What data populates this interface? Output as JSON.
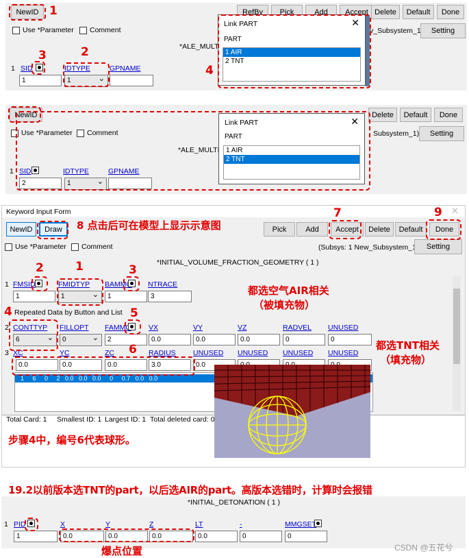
{
  "s1": {
    "newid": "NewID",
    "refby": "RefBy",
    "pick": "Pick",
    "add": "Add",
    "accept": "Accept",
    "delete": "Delete",
    "default": "Default",
    "done": "Done",
    "use_param": "Use *Parameter",
    "comment": "Comment",
    "subsys": "v_Subsystem_1)",
    "setting": "Setting",
    "keyword": "*ALE_MULTI",
    "row": "1",
    "sid": "SID",
    "idtype": "IDTYPE",
    "gpname": "GPNAME",
    "sid_val": "1",
    "idtype_val": "1",
    "dlg_title": "Link PART",
    "dlg_close": "✕",
    "dlg_part": "PART",
    "items": [
      "1  AIR",
      "2  TNT"
    ],
    "a1": "1",
    "a2": "2",
    "a3": "3",
    "a4": "4"
  },
  "s2": {
    "newid": "NewID",
    "delete": "Delete",
    "default": "Default",
    "done": "Done",
    "use_param": "Use *Parameter",
    "comment": "Comment",
    "subsys": "Subsystem_1)",
    "setting": "Setting",
    "keyword": "*ALE_MULTI",
    "row": "1",
    "sid": "SID",
    "idtype": "IDTYPE",
    "gpname": "GPNAME",
    "sid_val": "2",
    "idtype_val": "1",
    "dlg_title": "Link PART",
    "dlg_close": "✕",
    "dlg_part": "PART",
    "items": [
      "1  AIR",
      "2  TNT"
    ]
  },
  "s3": {
    "form_title": "Keyword Input Form",
    "close": "✕",
    "newid": "NewID",
    "draw": "Draw",
    "draw_note": "8 点击后可在模型上显示示意图",
    "n8": "",
    "pick": "Pick",
    "add": "Add",
    "accept": "Accept",
    "delete": "Delete",
    "default": "Default",
    "done": "Done",
    "n7": "7",
    "n9": "9",
    "use_param": "Use *Parameter",
    "comment": "Comment",
    "subsys": "(Subsys: 1 New_Subsystem_1)",
    "setting": "Setting",
    "keyword": "*INITIAL_VOLUME_FRACTION_GEOMETRY    ( 1 )",
    "row1": "1",
    "fmsid": "FMSID",
    "fmidtyp": "FMIDTYP",
    "bammg": "BAMMG",
    "ntrace": "NTRACE",
    "fmsid_val": "1",
    "fmidtyp_val": "1",
    "bammg_val": "1",
    "ntrace_val": "3",
    "n1": "1",
    "n2": "2",
    "n3": "3",
    "n4": "4",
    "n5": "5",
    "n6": "6",
    "note_air_1": "都选空气AIR相关",
    "note_air_2": "（被填充物）",
    "repeated": "Repeated Data by Button and List",
    "row2": "2",
    "conttyp": "CONTTYP",
    "fillopt": "FILLOPT",
    "fammg": "FAMMG",
    "vx": "VX",
    "vy": "VY",
    "vz": "VZ",
    "radvel": "RADVEL",
    "unused": "UNUSED",
    "conttyp_val": "6",
    "fillopt_val": "0",
    "fammg_val": "2",
    "vx_val": "0.0",
    "vy_val": "0.0",
    "vz_val": "0.0",
    "radvel_val": "0",
    "unused_val": "0",
    "note_tnt_1": "都选TNT相关",
    "note_tnt_2": "（填充物）",
    "row3": "3",
    "xc": "XC",
    "yc": "YC",
    "zc": "ZC",
    "radius": "RADIUS",
    "xc_val": "0.0",
    "yc_val": "0.0",
    "zc_val": "0.0",
    "radius_val": "3.0",
    "u1_val": "0.0",
    "u2_val": "0.0",
    "u3_val": "0.0",
    "u4_val": "0.0",
    "list_row": "1     6     0     2   0.0   0.0   0.0     0     0.7   0.0   0.0",
    "total_card": "Total Card: 1",
    "smallest": "Smallest ID: 1",
    "largest": "Largest ID: 1",
    "deleted": "Total deleted card: 0",
    "step_note": "步骤4中，编号6代表球形。"
  },
  "s4": {
    "version_note": "19.2以前版本选TNT的part，以后选AIR的part。高版本选错时，计算时会报错",
    "keyword": "*INITIAL_DETONATION    ( 1 )",
    "row": "1",
    "pid": "PID",
    "x": "X",
    "y": "Y",
    "z": "Z",
    "lt": "LT",
    "dash": "-",
    "mmgset": "MMGSET",
    "pid_val": "1",
    "x_val": "0.0",
    "y_val": "0.0",
    "z_val": "0.0",
    "lt_val": "0.0",
    "d_val": "0",
    "mmg_val": "0",
    "explosion": "爆点位置",
    "arrow": "⬆"
  },
  "watermark": "CSDN @五花兮",
  "colors": {
    "annotation": "#e00000",
    "select": "#0078d7",
    "mesh": "#8b1a1a",
    "sphere": "#ffff00"
  }
}
